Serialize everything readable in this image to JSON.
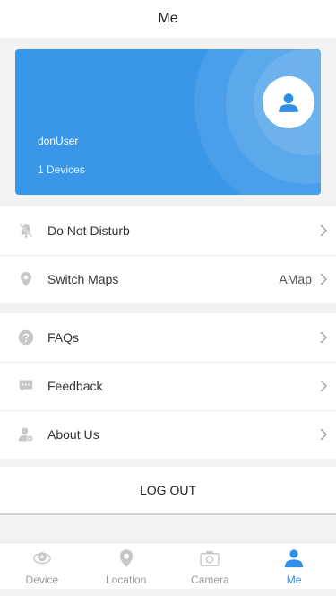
{
  "header": {
    "title": "Me"
  },
  "profile": {
    "username": "donUser",
    "devices": "1 Devices",
    "card_color": "#3a97e8"
  },
  "menu": {
    "group1": [
      {
        "label": "Do Not Disturb",
        "value": "",
        "icon": "bell-off-icon"
      },
      {
        "label": "Switch Maps",
        "value": "AMap",
        "icon": "map-pin-icon"
      }
    ],
    "group2": [
      {
        "label": "FAQs",
        "icon": "question-icon"
      },
      {
        "label": "Feedback",
        "icon": "chat-bubble-icon"
      },
      {
        "label": "About Us",
        "icon": "user-info-icon"
      }
    ]
  },
  "logout": {
    "label": "LOG OUT"
  },
  "tabs": [
    {
      "label": "Device",
      "icon": "device-icon",
      "active": false
    },
    {
      "label": "Location",
      "icon": "location-pin-icon",
      "active": false
    },
    {
      "label": "Camera",
      "icon": "camera-icon",
      "active": false
    },
    {
      "label": "Me",
      "icon": "person-icon",
      "active": true
    }
  ],
  "colors": {
    "accent": "#2f8fe6",
    "inactive": "#9a9a9a",
    "icon_gray": "#c7c7c7"
  }
}
